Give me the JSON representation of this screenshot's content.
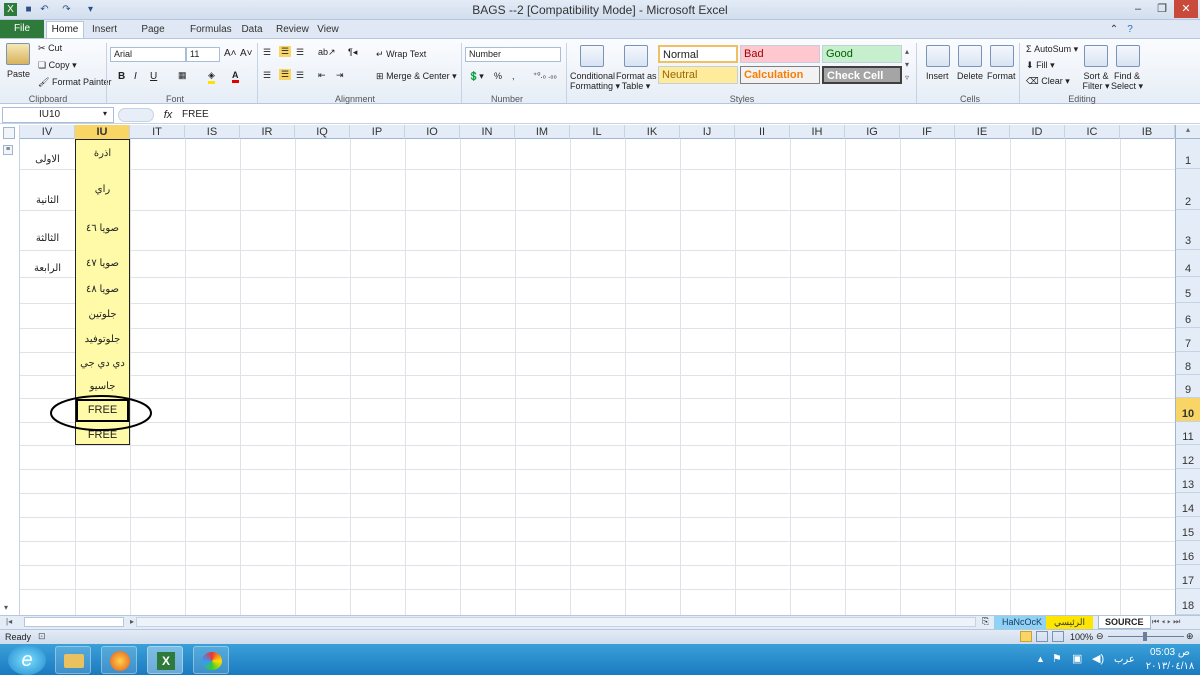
{
  "window": {
    "title": "BAGS --2  [Compatibility Mode] - Microsoft Excel"
  },
  "tabs": {
    "file": "File",
    "home": "Home",
    "insert": "Insert",
    "page_layout": "Page Layout",
    "formulas": "Formulas",
    "data": "Data",
    "review": "Review",
    "view": "View"
  },
  "clipboard": {
    "paste": "Paste",
    "cut": "Cut",
    "copy": "Copy",
    "format_painter": "Format Painter",
    "label": "Clipboard"
  },
  "font": {
    "name": "Arial",
    "size": "11",
    "label": "Font",
    "bold": "B",
    "italic": "I",
    "underline": "U"
  },
  "alignment": {
    "wrap": "Wrap Text",
    "merge": "Merge & Center",
    "label": "Alignment"
  },
  "number": {
    "format": "Number",
    "label": "Number",
    "percent": "%",
    "comma": ","
  },
  "styles": {
    "conditional": "Conditional",
    "conditional2": "Formatting",
    "format_table": "Format as",
    "format_table2": "Table",
    "normal": "Normal",
    "bad": "Bad",
    "good": "Good",
    "neutral": "Neutral",
    "calculation": "Calculation",
    "check": "Check Cell",
    "label": "Styles"
  },
  "cells": {
    "insert": "Insert",
    "delete": "Delete",
    "format": "Format",
    "label": "Cells"
  },
  "editing": {
    "autosum": "AutoSum",
    "fill": "Fill",
    "clear": "Clear",
    "sort": "Sort &",
    "sort2": "Filter",
    "find": "Find &",
    "find2": "Select",
    "label": "Editing"
  },
  "formula_bar": {
    "name_box": "IU10",
    "fx": "fx",
    "value": "FREE"
  },
  "columns": [
    "IV",
    "IU",
    "IT",
    "IS",
    "IR",
    "IQ",
    "IP",
    "IO",
    "IN",
    "IM",
    "IL",
    "IK",
    "IJ",
    "II",
    "IH",
    "IG",
    "IF",
    "IE",
    "ID",
    "IC",
    "IB"
  ],
  "rows": [
    "1",
    "2",
    "3",
    "4",
    "5",
    "6",
    "7",
    "8",
    "9",
    "10",
    "11",
    "12",
    "13",
    "14",
    "15",
    "16",
    "17",
    "18"
  ],
  "iv_cells": [
    "الاولى",
    "الثانية",
    "الثالثة",
    "الرابعة"
  ],
  "iu_cells": [
    "اذرة",
    "راي",
    "صويا ٤٦",
    "صويا ٤٧",
    "صويا ٤٨",
    "جلوتين",
    "جلوتوفيد",
    "دي دي جي",
    "جاسيو",
    "FREE",
    "FREE"
  ],
  "sheets": {
    "hancock": "HaNcOcK",
    "main": "الرئيسي",
    "source": "SOURCE"
  },
  "status": {
    "ready": "Ready",
    "zoom": "100%"
  },
  "taskbar": {
    "time": "05:03 ص",
    "date": "٢٠١٣/٠٤/١٨",
    "lang": "عرب"
  },
  "colors": {
    "file_tab": "#2e7a3a",
    "selected_cells": "#fffaa8",
    "highlight_row": "#f9d565"
  }
}
